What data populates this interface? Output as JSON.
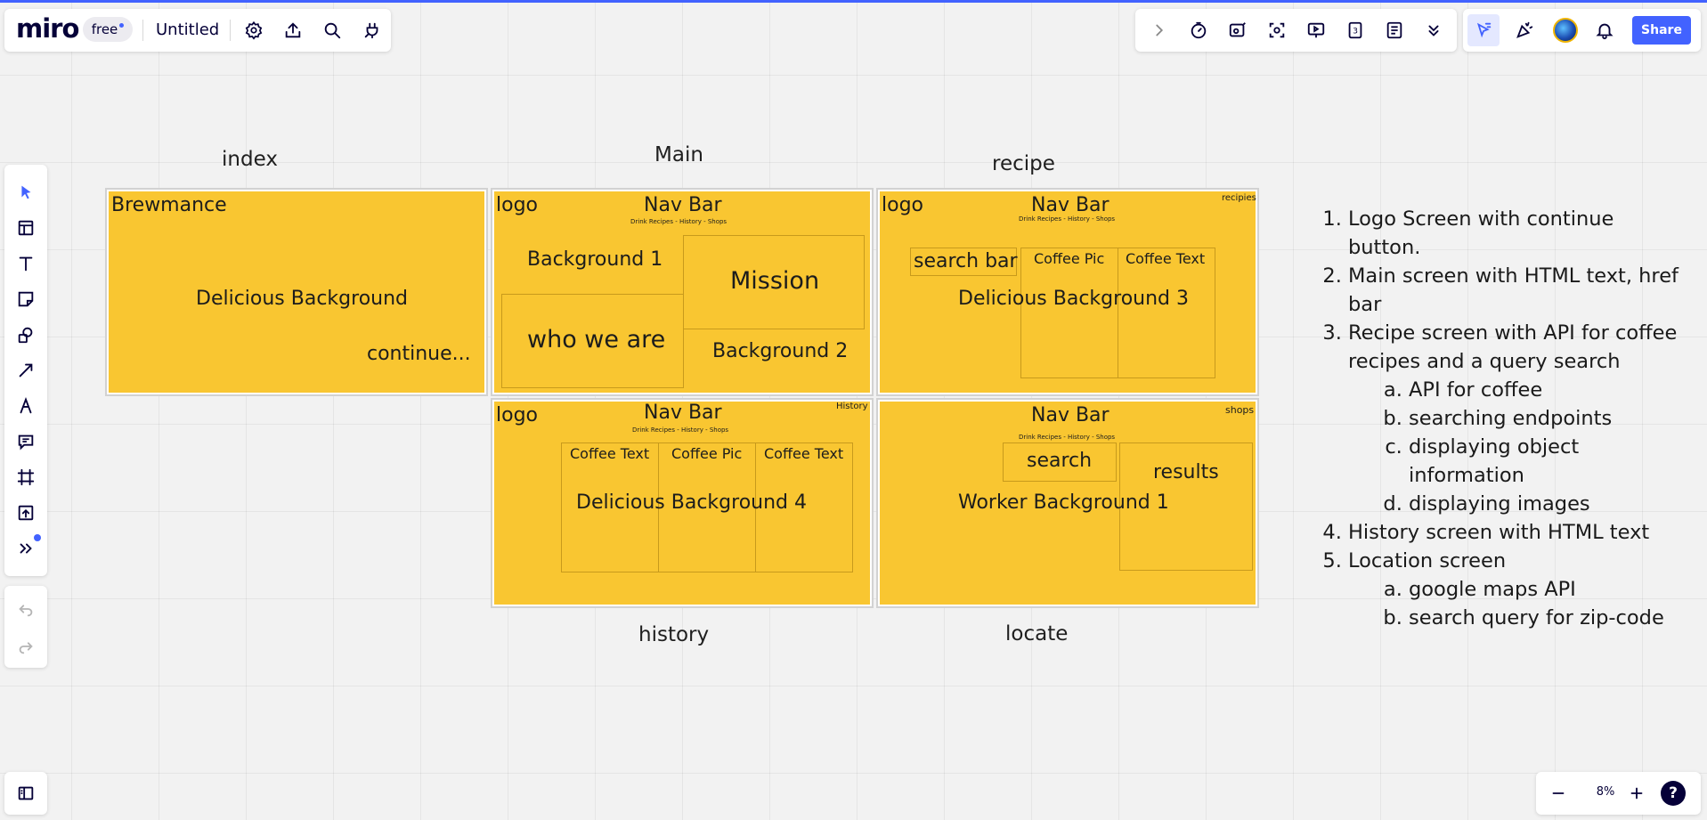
{
  "app": {
    "logo_text": "miro",
    "plan_badge": "free",
    "board_title": "Untitled",
    "share_label": "Share",
    "zoom_level": "8%",
    "help_label": "?"
  },
  "frames": {
    "index": {
      "frame_label": "index",
      "title": "Brewmance",
      "background": "Delicious Background",
      "continue": "continue..."
    },
    "main": {
      "frame_label": "Main",
      "logo": "logo",
      "nav": "Nav Bar",
      "nav_links": "Drink Recipes - History - Shops",
      "bg1": "Background 1",
      "mission": "Mission",
      "who": "who we are",
      "bg2": "Background 2"
    },
    "recipe": {
      "frame_label": "recipe",
      "logo": "logo",
      "nav": "Nav Bar",
      "nav_links": "Drink Recipes - History - Shops",
      "corner": "recipies",
      "search": "search bar",
      "pic": "Coffee Pic",
      "text": "Coffee Text",
      "background": "Delicious Background 3"
    },
    "history": {
      "frame_label": "history",
      "logo": "logo",
      "nav": "Nav Bar",
      "nav_links": "Drink Recipes - History - Shops",
      "corner": "History",
      "text1": "Coffee Text",
      "pic": "Coffee Pic",
      "text2": "Coffee Text",
      "background": "Delicious Background 4"
    },
    "locate": {
      "frame_label": "locate",
      "nav": "Nav Bar",
      "nav_links": "Drink Recipes - History - Shops",
      "corner": "shops",
      "search": "search",
      "results": "results",
      "background": "Worker Background 1"
    }
  },
  "notes": {
    "items": [
      {
        "text": "Logo Screen with continue button."
      },
      {
        "text": "Main screen with HTML text, href bar"
      },
      {
        "text": "Recipe screen with API for coffee recipes and a query search",
        "sub": [
          "API for coffee",
          "searching endpoints",
          "displaying object information",
          "displaying images"
        ]
      },
      {
        "text": "History screen with HTML text"
      },
      {
        "text": "Location screen",
        "sub": [
          "google maps API",
          "search query for zip-code"
        ]
      }
    ]
  },
  "colors": {
    "accent": "#4262ff",
    "sticky_yellow": "#f9c631"
  },
  "icons": {
    "top_left": [
      "settings-icon",
      "export-icon",
      "search-icon",
      "integrations-icon"
    ],
    "top_right": [
      "expand-icon",
      "timer-icon",
      "video-chat-icon",
      "focus-icon",
      "present-icon",
      "number-icon",
      "notes-icon",
      "more-chevron-icon"
    ],
    "left_toolbar": [
      "select-icon",
      "templates-icon",
      "text-icon",
      "sticky-note-icon",
      "shapes-icon",
      "connection-line-icon",
      "pen-icon",
      "comment-icon",
      "frame-icon",
      "upload-icon",
      "more-tools-icon"
    ]
  }
}
